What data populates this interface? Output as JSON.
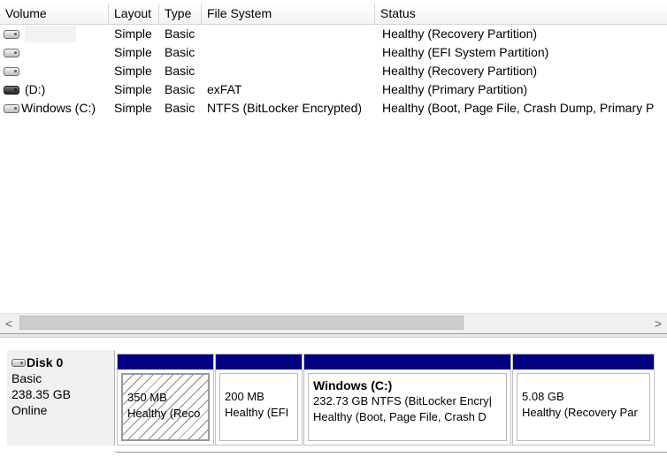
{
  "columns": {
    "volume": "Volume",
    "layout": "Layout",
    "type": "Type",
    "filesystem": "File System",
    "status": "Status"
  },
  "volumes": [
    {
      "name": "",
      "icon": "drive-icon",
      "layout": "Simple",
      "type": "Basic",
      "filesystem": "",
      "status": "Healthy (Recovery Partition)"
    },
    {
      "name": "",
      "icon": "drive-icon",
      "layout": "Simple",
      "type": "Basic",
      "filesystem": "",
      "status": "Healthy (EFI System Partition)"
    },
    {
      "name": "",
      "icon": "drive-icon",
      "layout": "Simple",
      "type": "Basic",
      "filesystem": "",
      "status": "Healthy (Recovery Partition)"
    },
    {
      "name": "(D:)",
      "icon": "removable-drive-icon",
      "layout": "Simple",
      "type": "Basic",
      "filesystem": "exFAT",
      "status": "Healthy (Primary Partition)"
    },
    {
      "name": "Windows (C:)",
      "icon": "drive-icon",
      "layout": "Simple",
      "type": "Basic",
      "filesystem": "NTFS (BitLocker Encrypted)",
      "status": "Healthy (Boot, Page File, Crash Dump, Primary P"
    }
  ],
  "scrollbar": {
    "left_arrow": "<",
    "right_arrow": ">"
  },
  "disk": {
    "name": "Disk 0",
    "type": "Basic",
    "size": "238.35 GB",
    "state": "Online",
    "partitions": [
      {
        "title": "",
        "line1": "350 MB",
        "line2": "Healthy (Reco",
        "selected": true
      },
      {
        "title": "",
        "line1": "200 MB",
        "line2": "Healthy (EFI",
        "selected": false
      },
      {
        "title": "Windows (C:)",
        "line1": "232.73 GB NTFS (BitLocker Encry|",
        "line2": "Healthy (Boot, Page File, Crash D",
        "selected": false
      },
      {
        "title": "",
        "line1": "5.08 GB",
        "line2": "Healthy (Recovery Par",
        "selected": false
      }
    ]
  },
  "colors": {
    "partition_bar": "#000080",
    "selection_hatch": "#8a8a8a"
  }
}
